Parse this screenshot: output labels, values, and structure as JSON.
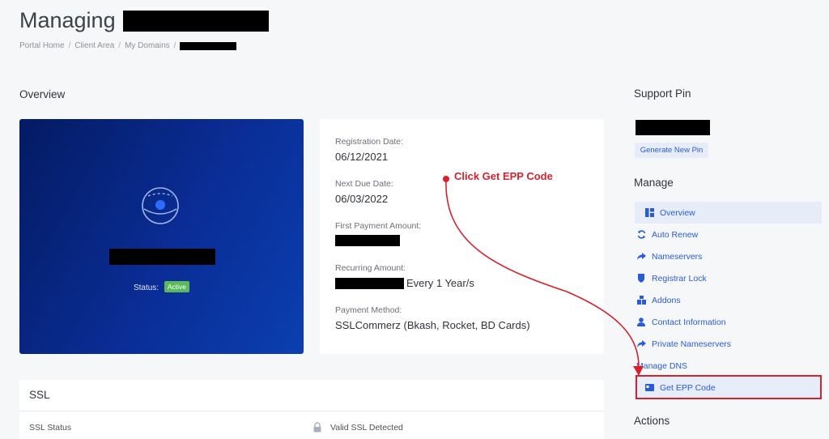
{
  "page": {
    "title": "Managing",
    "breadcrumb": [
      "Portal Home",
      "Client Area",
      "My Domains"
    ]
  },
  "overview": {
    "heading": "Overview",
    "status_label": "Status:",
    "status_badge": "Active",
    "details": {
      "registration_label": "Registration Date:",
      "registration_value": "06/12/2021",
      "next_due_label": "Next Due Date:",
      "next_due_value": "06/03/2022",
      "first_payment_label": "First Payment Amount:",
      "recurring_label": "Recurring Amount:",
      "recurring_suffix": "Every 1 Year/s",
      "payment_method_label": "Payment Method:",
      "payment_method_value": "SSLCommerz (Bkash, Rocket, BD Cards)"
    }
  },
  "ssl": {
    "heading": "SSL",
    "status_label": "SSL Status",
    "status_value": "Valid SSL Detected"
  },
  "sidebar": {
    "support_pin_heading": "Support Pin",
    "generate_pin_label": "Generate New Pin",
    "manage_heading": "Manage",
    "items": [
      {
        "label": "Overview",
        "icon": "dashboard-icon"
      },
      {
        "label": "Auto Renew",
        "icon": "refresh-icon"
      },
      {
        "label": "Nameservers",
        "icon": "share-arrow-icon"
      },
      {
        "label": "Registrar Lock",
        "icon": "shield-icon"
      },
      {
        "label": "Addons",
        "icon": "cubes-icon"
      },
      {
        "label": "Contact Information",
        "icon": "user-icon"
      },
      {
        "label": "Private Nameservers",
        "icon": "share-arrow-icon"
      },
      {
        "label": "Manage DNS",
        "icon": ""
      },
      {
        "label": "Get EPP Code",
        "icon": "id-card-icon"
      }
    ],
    "actions_heading": "Actions"
  },
  "annotation": {
    "text": "Click Get EPP Code",
    "color": "#d4232d"
  },
  "colors": {
    "accent": "#2a5bd7",
    "hero_gradient_start": "#041b63",
    "hero_gradient_end": "#0a3fb0",
    "active_badge": "#5cb85c"
  }
}
